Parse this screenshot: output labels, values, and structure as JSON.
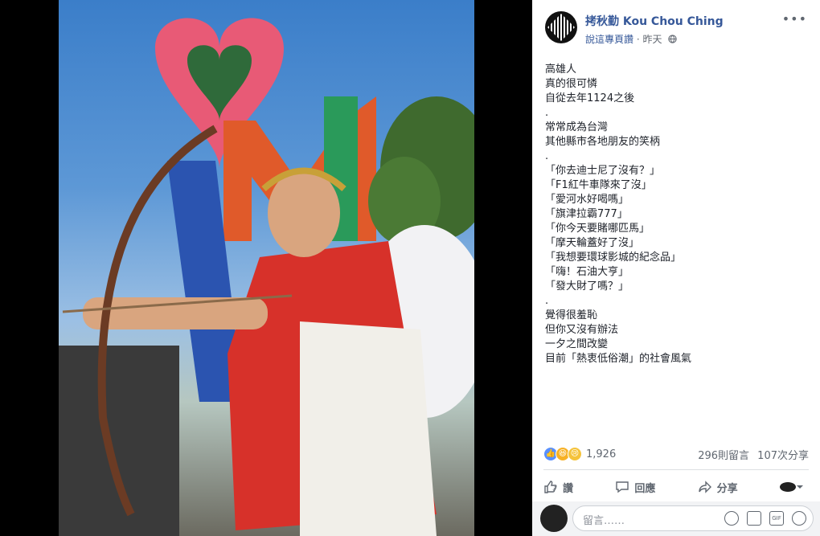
{
  "post": {
    "author": "拷秋勤 Kou Chou Ching",
    "meta_link": "說這專頁讚",
    "meta_sep": " · ",
    "time": "昨天",
    "privacy_icon": "globe-icon",
    "text_lines": [
      "高雄人",
      "真的很可憐",
      "自從去年1124之後",
      ".",
      "常常成為台灣",
      "其他縣市各地朋友的笑柄",
      ".",
      "「你去迪士尼了沒有？」",
      "「F1紅牛車隊來了沒」",
      "「愛河水好喝嗎」",
      "「旗津拉霸777」",
      "「你今天要賭哪匹馬」",
      "「摩天輪蓋好了沒」",
      "「我想要環球影城的紀念品」",
      "「嗨！石油大亨」",
      "「發大財了嗎？」",
      ".",
      "覺得很羞恥",
      "但你又沒有辦法",
      "一夕之間改變",
      "目前「熱衷低俗潮」的社會風氣"
    ]
  },
  "reactions": {
    "count": "1,926",
    "icons": [
      "like-icon",
      "haha-icon",
      "sad-icon"
    ]
  },
  "stats": {
    "comments": "296則留言",
    "shares": "107次分享"
  },
  "actions": {
    "like": "讚",
    "comment": "回應",
    "share": "分享"
  },
  "comment_box": {
    "placeholder": "留言……"
  },
  "colors": {
    "link": "#365899",
    "text": "#1d2129",
    "muted": "#606770"
  }
}
